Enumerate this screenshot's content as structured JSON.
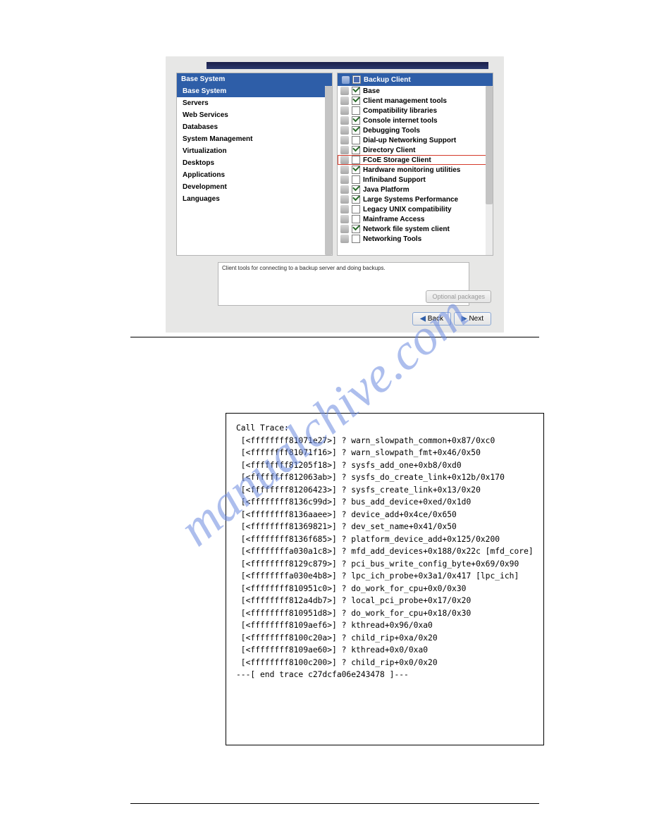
{
  "watermark": "manualchive.com",
  "installer": {
    "left": {
      "header": "Base System",
      "categories": [
        {
          "label": "Base System",
          "selected": true
        },
        {
          "label": "Servers",
          "selected": false
        },
        {
          "label": "Web Services",
          "selected": false
        },
        {
          "label": "Databases",
          "selected": false
        },
        {
          "label": "System Management",
          "selected": false
        },
        {
          "label": "Virtualization",
          "selected": false
        },
        {
          "label": "Desktops",
          "selected": false
        },
        {
          "label": "Applications",
          "selected": false
        },
        {
          "label": "Development",
          "selected": false
        },
        {
          "label": "Languages",
          "selected": false
        }
      ]
    },
    "right": {
      "header": "Backup Client",
      "packages": [
        {
          "label": "Base",
          "checked": true,
          "highlight": false
        },
        {
          "label": "Client management tools",
          "checked": true,
          "highlight": false
        },
        {
          "label": "Compatibility libraries",
          "checked": false,
          "highlight": false
        },
        {
          "label": "Console internet tools",
          "checked": true,
          "highlight": false
        },
        {
          "label": "Debugging Tools",
          "checked": true,
          "highlight": false
        },
        {
          "label": "Dial-up Networking Support",
          "checked": false,
          "highlight": false
        },
        {
          "label": "Directory Client",
          "checked": true,
          "highlight": false
        },
        {
          "label": "FCoE Storage Client",
          "checked": false,
          "highlight": true
        },
        {
          "label": "Hardware monitoring utilities",
          "checked": true,
          "highlight": false
        },
        {
          "label": "Infiniband Support",
          "checked": false,
          "highlight": false
        },
        {
          "label": "Java Platform",
          "checked": true,
          "highlight": false
        },
        {
          "label": "Large Systems Performance",
          "checked": true,
          "highlight": false
        },
        {
          "label": "Legacy UNIX compatibility",
          "checked": false,
          "highlight": false
        },
        {
          "label": "Mainframe Access",
          "checked": false,
          "highlight": false
        },
        {
          "label": "Network file system client",
          "checked": true,
          "highlight": false
        },
        {
          "label": "Networking Tools",
          "checked": false,
          "highlight": false
        }
      ]
    },
    "description": "Client tools for connecting to a backup server and doing backups.",
    "optional_button": "Optional packages",
    "back_button": "Back",
    "next_button": "Next"
  },
  "trace": {
    "header": "Call Trace:",
    "lines": [
      " [<ffffffff81071e27>] ? warn_slowpath_common+0x87/0xc0",
      " [<ffffffff81071f16>] ? warn_slowpath_fmt+0x46/0x50",
      " [<ffffffff81205f18>] ? sysfs_add_one+0xb8/0xd0",
      " [<ffffffff812063ab>] ? sysfs_do_create_link+0x12b/0x170",
      " [<ffffffff81206423>] ? sysfs_create_link+0x13/0x20",
      " [<ffffffff8136c99d>] ? bus_add_device+0xed/0x1d0",
      " [<ffffffff8136aaee>] ? device_add+0x4ce/0x650",
      " [<ffffffff81369821>] ? dev_set_name+0x41/0x50",
      " [<ffffffff8136f685>] ? platform_device_add+0x125/0x200",
      " [<ffffffffa030a1c8>] ? mfd_add_devices+0x188/0x22c [mfd_core]",
      " [<ffffffff8129c879>] ? pci_bus_write_config_byte+0x69/0x90",
      " [<ffffffffa030e4b8>] ? lpc_ich_probe+0x3a1/0x417 [lpc_ich]",
      " [<ffffffff810951c0>] ? do_work_for_cpu+0x0/0x30",
      " [<ffffffff812a4db7>] ? local_pci_probe+0x17/0x20",
      " [<ffffffff810951d8>] ? do_work_for_cpu+0x18/0x30",
      " [<ffffffff8109aef6>] ? kthread+0x96/0xa0",
      " [<ffffffff8100c20a>] ? child_rip+0xa/0x20",
      " [<ffffffff8109ae60>] ? kthread+0x0/0xa0",
      " [<ffffffff8100c200>] ? child_rip+0x0/0x20"
    ],
    "footer": "---[ end trace c27dcfa06e243478 ]---"
  }
}
